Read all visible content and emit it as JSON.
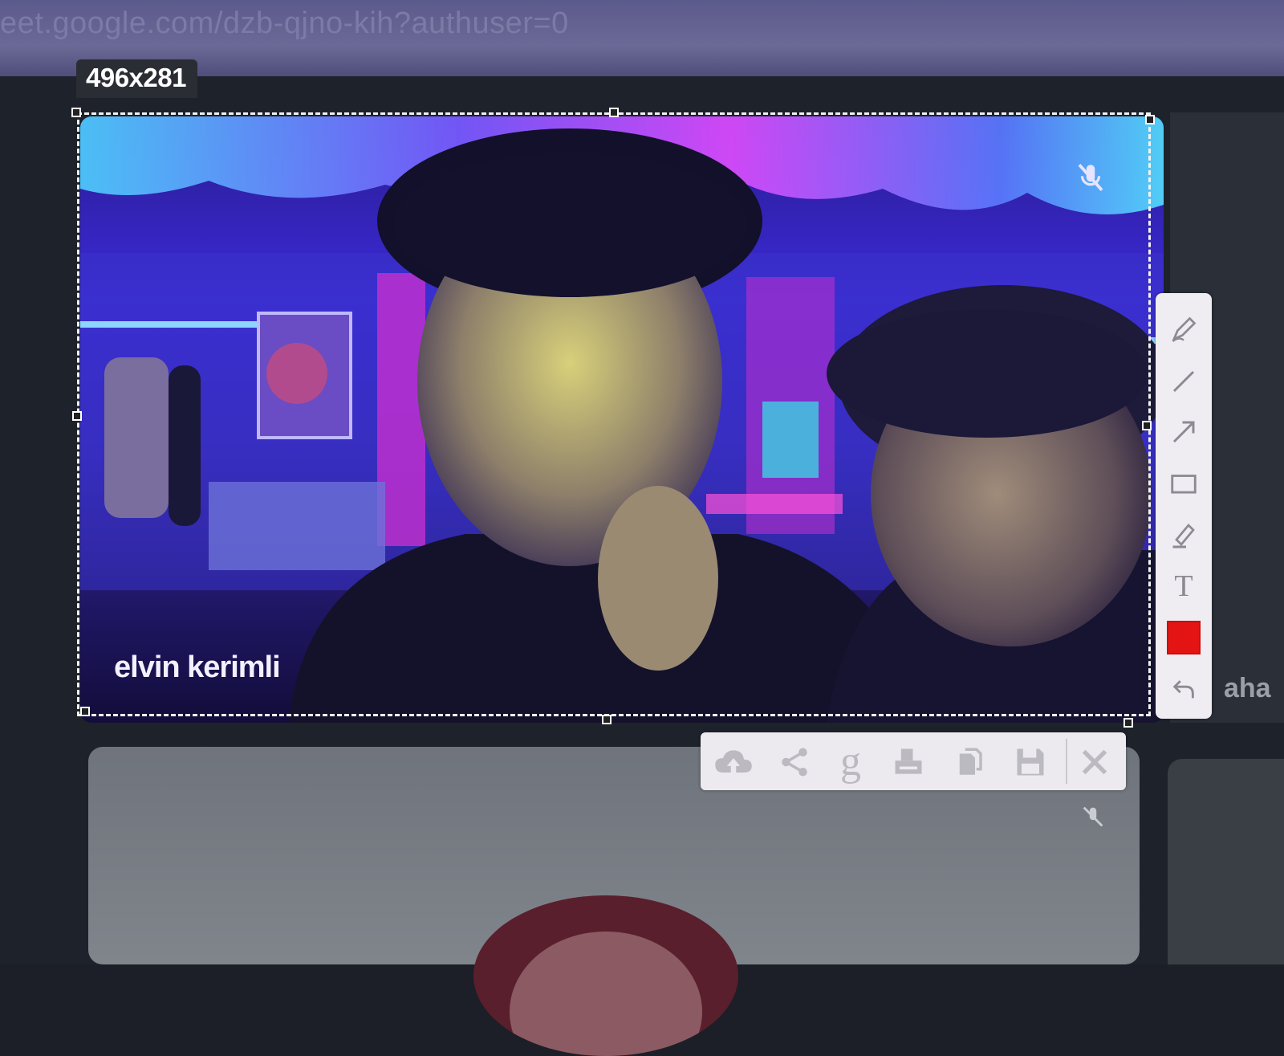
{
  "browser": {
    "url": "eet.google.com/dzb-qjno-kih?authuser=0"
  },
  "selection": {
    "dimensions_label": "496x281"
  },
  "video_tile": {
    "participant_name": "elvin kerimli",
    "mic_muted": true
  },
  "side_tile": {
    "participant_name_partial": "aha"
  },
  "annotation_tools": {
    "items": [
      {
        "id": "pen",
        "icon": "pen-icon"
      },
      {
        "id": "line",
        "icon": "line-icon"
      },
      {
        "id": "arrow",
        "icon": "arrow-icon"
      },
      {
        "id": "rectangle",
        "icon": "rectangle-icon"
      },
      {
        "id": "marker",
        "icon": "marker-icon"
      },
      {
        "id": "text",
        "icon": "text-icon",
        "glyph": "T"
      },
      {
        "id": "color",
        "icon": "color-swatch",
        "color": "#e41414"
      },
      {
        "id": "undo",
        "icon": "undo-icon"
      }
    ]
  },
  "capture_actions": {
    "items": [
      {
        "id": "upload",
        "icon": "cloud-upload-icon"
      },
      {
        "id": "share",
        "icon": "share-icon"
      },
      {
        "id": "google-search",
        "icon": "google-icon",
        "glyph": "g"
      },
      {
        "id": "print",
        "icon": "print-icon"
      },
      {
        "id": "copy",
        "icon": "copy-icon"
      },
      {
        "id": "save",
        "icon": "save-icon"
      },
      {
        "id": "close",
        "icon": "close-icon"
      }
    ]
  }
}
